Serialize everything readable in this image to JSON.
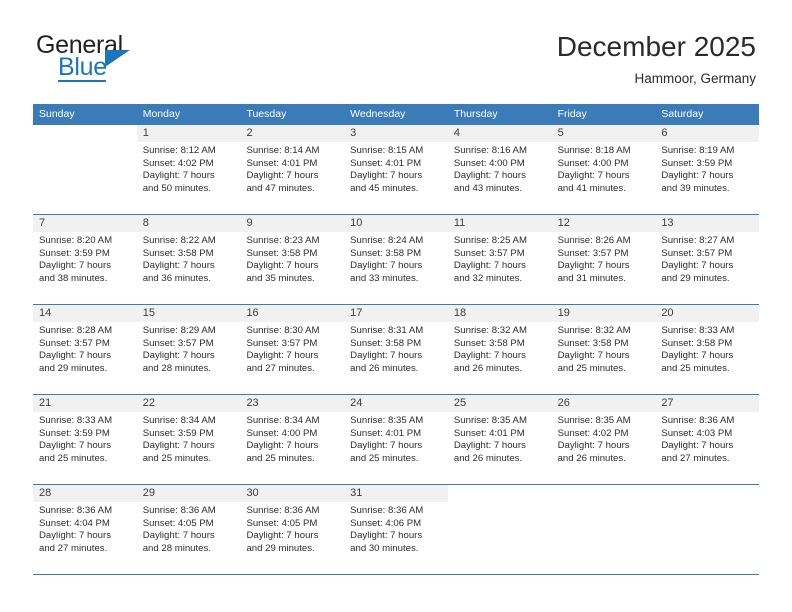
{
  "logo": {
    "word_top": "General",
    "word_bottom": "Blue",
    "accent_color": "#1b76bc"
  },
  "header": {
    "title": "December 2025",
    "subtitle": "Hammoor, Germany"
  },
  "theme": {
    "header_band": "#3b7cb8",
    "day_number_bg": "#f1f1f1",
    "text": "#2d2d2d"
  },
  "weekdays": [
    "Sunday",
    "Monday",
    "Tuesday",
    "Wednesday",
    "Thursday",
    "Friday",
    "Saturday"
  ],
  "labels": {
    "sunrise": "Sunrise:",
    "sunset": "Sunset:",
    "daylight": "Daylight:"
  },
  "weeks": [
    [
      {
        "day": "",
        "sunrise": "",
        "sunset": "",
        "daylight_1": "",
        "daylight_2": ""
      },
      {
        "day": "1",
        "sunrise": "Sunrise: 8:12 AM",
        "sunset": "Sunset: 4:02 PM",
        "daylight_1": "Daylight: 7 hours",
        "daylight_2": "and 50 minutes."
      },
      {
        "day": "2",
        "sunrise": "Sunrise: 8:14 AM",
        "sunset": "Sunset: 4:01 PM",
        "daylight_1": "Daylight: 7 hours",
        "daylight_2": "and 47 minutes."
      },
      {
        "day": "3",
        "sunrise": "Sunrise: 8:15 AM",
        "sunset": "Sunset: 4:01 PM",
        "daylight_1": "Daylight: 7 hours",
        "daylight_2": "and 45 minutes."
      },
      {
        "day": "4",
        "sunrise": "Sunrise: 8:16 AM",
        "sunset": "Sunset: 4:00 PM",
        "daylight_1": "Daylight: 7 hours",
        "daylight_2": "and 43 minutes."
      },
      {
        "day": "5",
        "sunrise": "Sunrise: 8:18 AM",
        "sunset": "Sunset: 4:00 PM",
        "daylight_1": "Daylight: 7 hours",
        "daylight_2": "and 41 minutes."
      },
      {
        "day": "6",
        "sunrise": "Sunrise: 8:19 AM",
        "sunset": "Sunset: 3:59 PM",
        "daylight_1": "Daylight: 7 hours",
        "daylight_2": "and 39 minutes."
      }
    ],
    [
      {
        "day": "7",
        "sunrise": "Sunrise: 8:20 AM",
        "sunset": "Sunset: 3:59 PM",
        "daylight_1": "Daylight: 7 hours",
        "daylight_2": "and 38 minutes."
      },
      {
        "day": "8",
        "sunrise": "Sunrise: 8:22 AM",
        "sunset": "Sunset: 3:58 PM",
        "daylight_1": "Daylight: 7 hours",
        "daylight_2": "and 36 minutes."
      },
      {
        "day": "9",
        "sunrise": "Sunrise: 8:23 AM",
        "sunset": "Sunset: 3:58 PM",
        "daylight_1": "Daylight: 7 hours",
        "daylight_2": "and 35 minutes."
      },
      {
        "day": "10",
        "sunrise": "Sunrise: 8:24 AM",
        "sunset": "Sunset: 3:58 PM",
        "daylight_1": "Daylight: 7 hours",
        "daylight_2": "and 33 minutes."
      },
      {
        "day": "11",
        "sunrise": "Sunrise: 8:25 AM",
        "sunset": "Sunset: 3:57 PM",
        "daylight_1": "Daylight: 7 hours",
        "daylight_2": "and 32 minutes."
      },
      {
        "day": "12",
        "sunrise": "Sunrise: 8:26 AM",
        "sunset": "Sunset: 3:57 PM",
        "daylight_1": "Daylight: 7 hours",
        "daylight_2": "and 31 minutes."
      },
      {
        "day": "13",
        "sunrise": "Sunrise: 8:27 AM",
        "sunset": "Sunset: 3:57 PM",
        "daylight_1": "Daylight: 7 hours",
        "daylight_2": "and 29 minutes."
      }
    ],
    [
      {
        "day": "14",
        "sunrise": "Sunrise: 8:28 AM",
        "sunset": "Sunset: 3:57 PM",
        "daylight_1": "Daylight: 7 hours",
        "daylight_2": "and 29 minutes."
      },
      {
        "day": "15",
        "sunrise": "Sunrise: 8:29 AM",
        "sunset": "Sunset: 3:57 PM",
        "daylight_1": "Daylight: 7 hours",
        "daylight_2": "and 28 minutes."
      },
      {
        "day": "16",
        "sunrise": "Sunrise: 8:30 AM",
        "sunset": "Sunset: 3:57 PM",
        "daylight_1": "Daylight: 7 hours",
        "daylight_2": "and 27 minutes."
      },
      {
        "day": "17",
        "sunrise": "Sunrise: 8:31 AM",
        "sunset": "Sunset: 3:58 PM",
        "daylight_1": "Daylight: 7 hours",
        "daylight_2": "and 26 minutes."
      },
      {
        "day": "18",
        "sunrise": "Sunrise: 8:32 AM",
        "sunset": "Sunset: 3:58 PM",
        "daylight_1": "Daylight: 7 hours",
        "daylight_2": "and 26 minutes."
      },
      {
        "day": "19",
        "sunrise": "Sunrise: 8:32 AM",
        "sunset": "Sunset: 3:58 PM",
        "daylight_1": "Daylight: 7 hours",
        "daylight_2": "and 25 minutes."
      },
      {
        "day": "20",
        "sunrise": "Sunrise: 8:33 AM",
        "sunset": "Sunset: 3:58 PM",
        "daylight_1": "Daylight: 7 hours",
        "daylight_2": "and 25 minutes."
      }
    ],
    [
      {
        "day": "21",
        "sunrise": "Sunrise: 8:33 AM",
        "sunset": "Sunset: 3:59 PM",
        "daylight_1": "Daylight: 7 hours",
        "daylight_2": "and 25 minutes."
      },
      {
        "day": "22",
        "sunrise": "Sunrise: 8:34 AM",
        "sunset": "Sunset: 3:59 PM",
        "daylight_1": "Daylight: 7 hours",
        "daylight_2": "and 25 minutes."
      },
      {
        "day": "23",
        "sunrise": "Sunrise: 8:34 AM",
        "sunset": "Sunset: 4:00 PM",
        "daylight_1": "Daylight: 7 hours",
        "daylight_2": "and 25 minutes."
      },
      {
        "day": "24",
        "sunrise": "Sunrise: 8:35 AM",
        "sunset": "Sunset: 4:01 PM",
        "daylight_1": "Daylight: 7 hours",
        "daylight_2": "and 25 minutes."
      },
      {
        "day": "25",
        "sunrise": "Sunrise: 8:35 AM",
        "sunset": "Sunset: 4:01 PM",
        "daylight_1": "Daylight: 7 hours",
        "daylight_2": "and 26 minutes."
      },
      {
        "day": "26",
        "sunrise": "Sunrise: 8:35 AM",
        "sunset": "Sunset: 4:02 PM",
        "daylight_1": "Daylight: 7 hours",
        "daylight_2": "and 26 minutes."
      },
      {
        "day": "27",
        "sunrise": "Sunrise: 8:36 AM",
        "sunset": "Sunset: 4:03 PM",
        "daylight_1": "Daylight: 7 hours",
        "daylight_2": "and 27 minutes."
      }
    ],
    [
      {
        "day": "28",
        "sunrise": "Sunrise: 8:36 AM",
        "sunset": "Sunset: 4:04 PM",
        "daylight_1": "Daylight: 7 hours",
        "daylight_2": "and 27 minutes."
      },
      {
        "day": "29",
        "sunrise": "Sunrise: 8:36 AM",
        "sunset": "Sunset: 4:05 PM",
        "daylight_1": "Daylight: 7 hours",
        "daylight_2": "and 28 minutes."
      },
      {
        "day": "30",
        "sunrise": "Sunrise: 8:36 AM",
        "sunset": "Sunset: 4:05 PM",
        "daylight_1": "Daylight: 7 hours",
        "daylight_2": "and 29 minutes."
      },
      {
        "day": "31",
        "sunrise": "Sunrise: 8:36 AM",
        "sunset": "Sunset: 4:06 PM",
        "daylight_1": "Daylight: 7 hours",
        "daylight_2": "and 30 minutes."
      },
      {
        "day": "",
        "sunrise": "",
        "sunset": "",
        "daylight_1": "",
        "daylight_2": ""
      },
      {
        "day": "",
        "sunrise": "",
        "sunset": "",
        "daylight_1": "",
        "daylight_2": ""
      },
      {
        "day": "",
        "sunrise": "",
        "sunset": "",
        "daylight_1": "",
        "daylight_2": ""
      }
    ]
  ]
}
